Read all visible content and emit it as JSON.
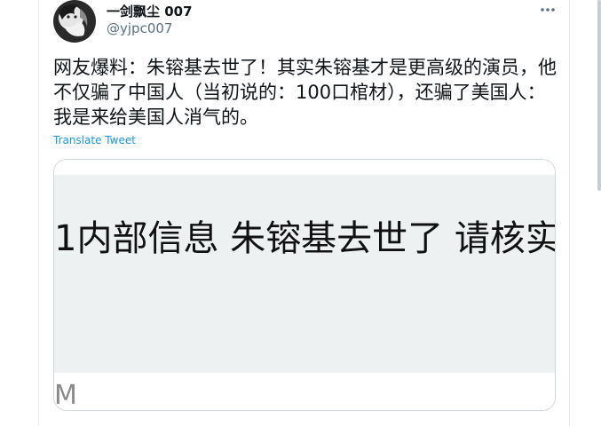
{
  "tweet": {
    "display_name": "一剑飘尘 007",
    "handle": "@yjpc007",
    "text": "网友爆料：朱镕基去世了！其实朱镕基才是更高级的演员，他不仅骗了中国人（当初说的：100口棺材），还骗了美国人：我是来给美国人消气的。",
    "translate_label": "Translate Tweet",
    "more_icon": "more-horizontal-icon",
    "media": {
      "headline": "1内部信息 朱镕基去世了 请核实",
      "partial_text": "M"
    }
  },
  "colors": {
    "text": "#0f1419",
    "secondary": "#5b7083",
    "link": "#1b95e0",
    "border": "#cfd9de",
    "media_background": "#eef1f2"
  }
}
